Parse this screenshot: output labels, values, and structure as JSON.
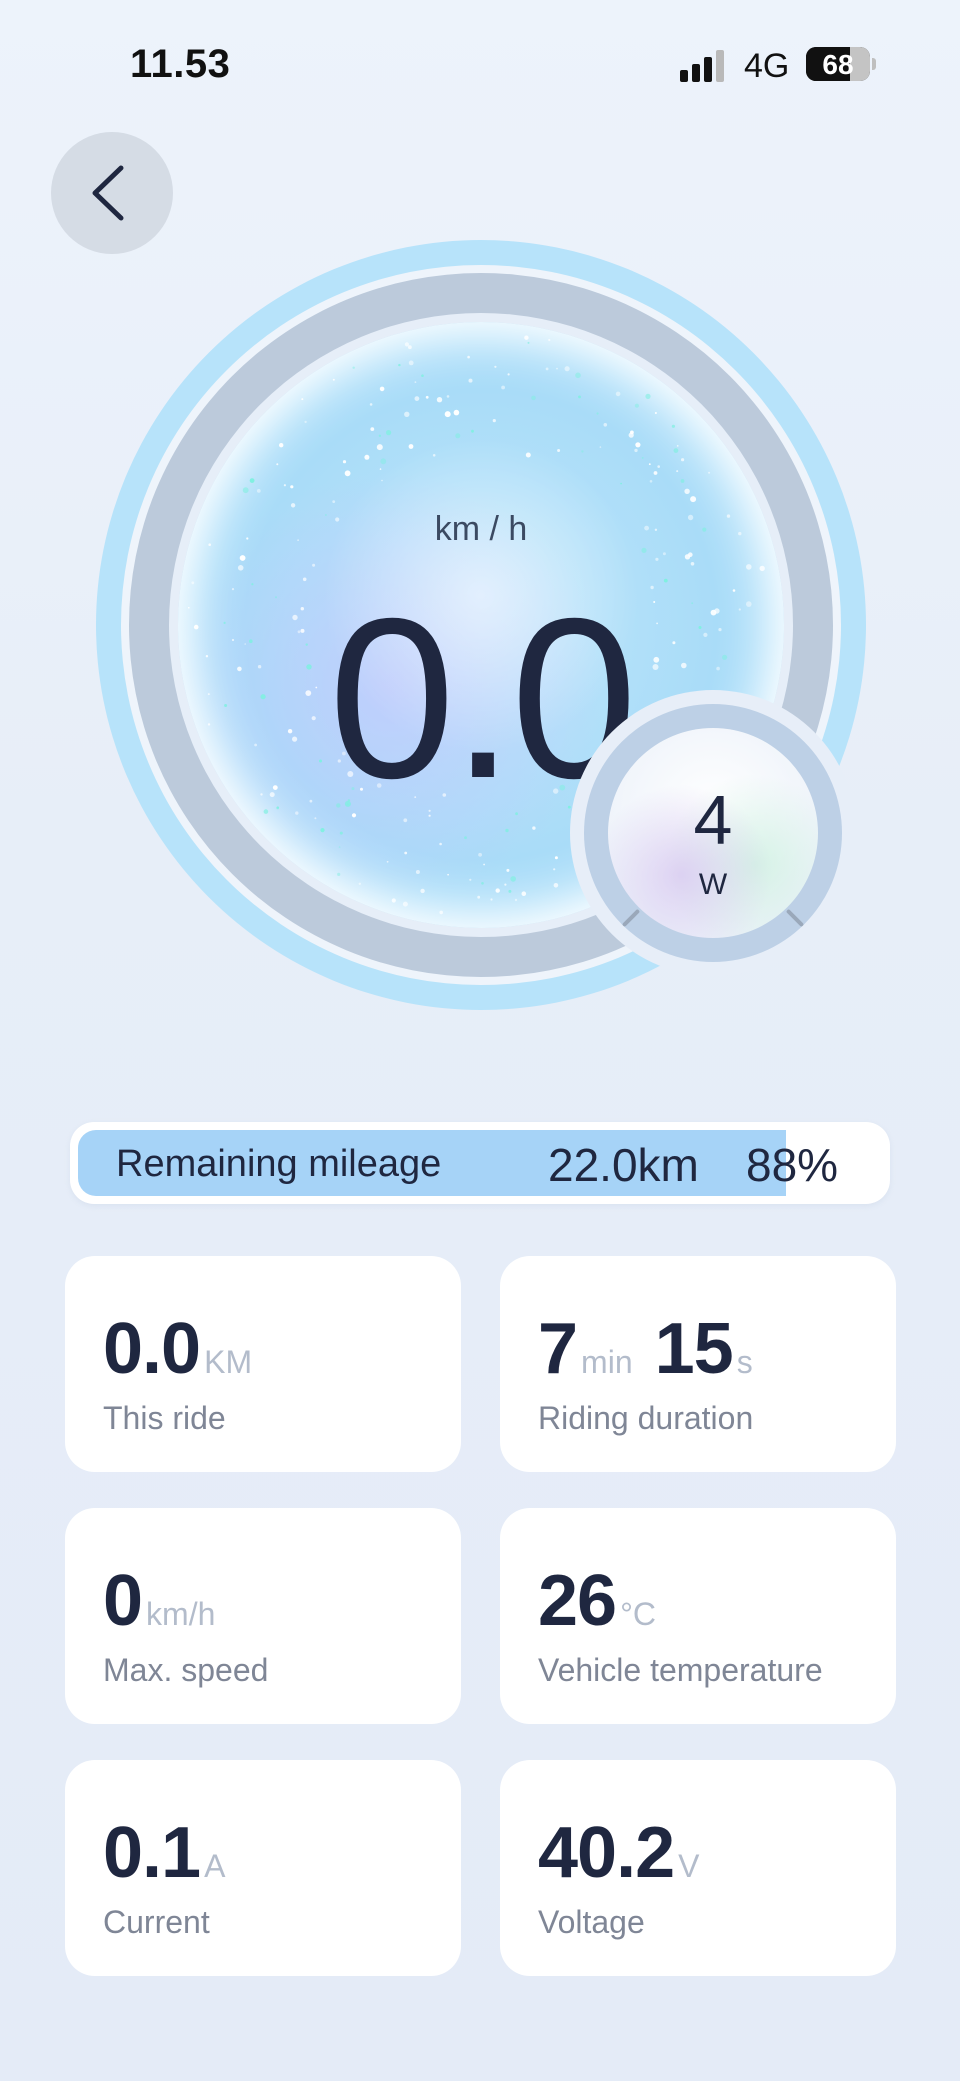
{
  "status_bar": {
    "time": "11.53",
    "network": "4G",
    "battery": "68",
    "battery_level": 0.68
  },
  "back": {
    "icon": "chevron-left-icon"
  },
  "gauge": {
    "unit": "km / h",
    "speed": "0.0",
    "power_value": "4",
    "power_unit": "W"
  },
  "mileage": {
    "label": "Remaining mileage",
    "distance": "22.0km",
    "percent": "88%",
    "level": 0.88
  },
  "stats": {
    "ride": {
      "value": "0.0",
      "unit": "KM",
      "label": "This ride"
    },
    "duration": {
      "min": "7",
      "min_unit": "min",
      "sec": "15",
      "sec_unit": "s",
      "label": "Riding duration"
    },
    "max_speed": {
      "value": "0",
      "unit": "km/h",
      "label": "Max. speed"
    },
    "temperature": {
      "value": "26",
      "unit": "°C",
      "label": "Vehicle temperature"
    },
    "current": {
      "value": "0.1",
      "unit": "A",
      "label": "Current"
    },
    "voltage": {
      "value": "40.2",
      "unit": "V",
      "label": "Voltage"
    }
  },
  "colors": {
    "accent": "#a6d3f7",
    "ring_outer": "#b7e3fa",
    "ring_inner": "#bdcadb",
    "text_dark": "#1f2740",
    "text_muted": "#7f8696"
  }
}
